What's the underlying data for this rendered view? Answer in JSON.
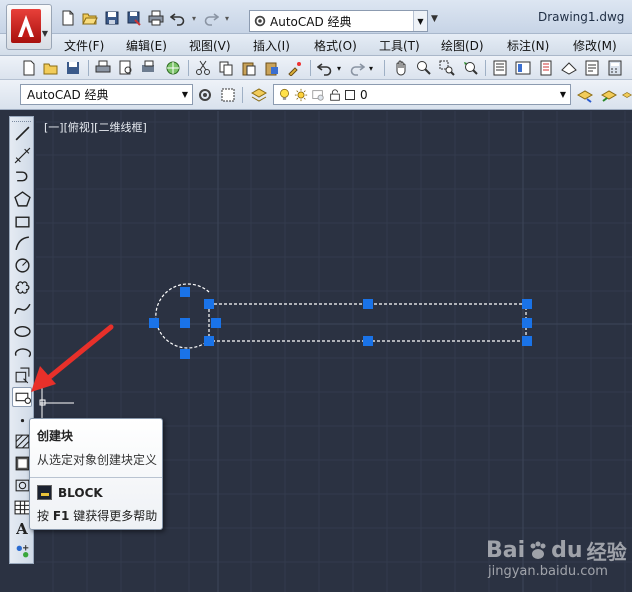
{
  "window": {
    "workspace": "AutoCAD 经典",
    "document_title": "Drawing1.dwg"
  },
  "menu": [
    "文件(F)",
    "编辑(E)",
    "视图(V)",
    "插入(I)",
    "格式(O)",
    "工具(T)",
    "绘图(D)",
    "标注(N)",
    "修改(M)"
  ],
  "toolbar2": {
    "workspace_combo": "AutoCAD 经典",
    "layer_combo": "0"
  },
  "canvas": {
    "viewport_label": "[一][俯视][二维线框]",
    "background": "#2b3242",
    "grip_color": "#1a73e8"
  },
  "tooltip": {
    "title": "创建块",
    "description": "从选定对象创建块定义",
    "command": "BLOCK",
    "help_prefix": "按",
    "help_key": "F1",
    "help_suffix": "键获得更多帮助"
  },
  "watermark": {
    "brand": "Bai",
    "brand2": "du",
    "brand3": "经验",
    "url": "jingyan.baidu.com"
  },
  "colors": {
    "arrow": "#e8302a",
    "accent": "#c31a15"
  }
}
